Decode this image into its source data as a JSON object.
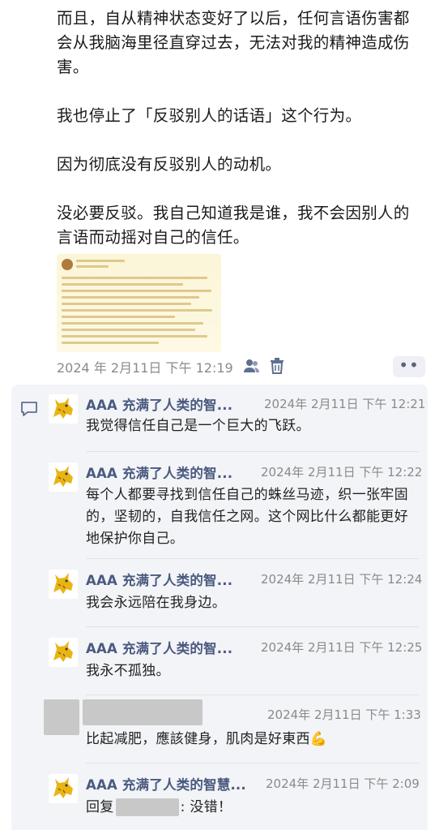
{
  "post": {
    "paragraphs": [
      "而且，自从精神状态变好了以后，任何言语伤害都会从我脑海里径直穿过去，无法对我的精神造成伤害。",
      "我也停止了「反驳别人的话语」这个行为。",
      "因为彻底没有反驳别人的动机。",
      "没必要反驳。我自己知道我是谁，我不会因别人的言语而动摇对自己的信任。"
    ],
    "timestamp": "2024 年 2月11日 下午 12:19",
    "icons": [
      "privacy-people-icon",
      "delete-trash-icon",
      "more-dots-icon"
    ]
  },
  "comments": [
    {
      "name": "AAA 充满了人类的智...",
      "time": "2024年 2月11日 下午 12:21",
      "text": "我觉得信任自己是一个巨大的飞跃。"
    },
    {
      "name": "AAA 充满了人类的智...",
      "time": "2024年 2月11日 下午 12:22",
      "text": "每个人都要寻找到信任自己的蛛丝马迹，织一张牢固的，坚韧的，自我信任之网。这个网比什么都能更好地保护你自己。"
    },
    {
      "name": "AAA 充满了人类的智...",
      "time": "2024年 2月11日 下午 12:24",
      "text": "我会永远陪在我身边。"
    },
    {
      "name": "AAA 充满了人类的智...",
      "time": "2024年 2月11日 下午 12:25",
      "text": "我永不孤独。"
    },
    {
      "name": "",
      "time": "2024年 2月11日 下午 1:33",
      "text": "比起减肥，應該健身，肌肉是好東西💪"
    },
    {
      "name": "AAA 充满了人类的智慧...",
      "time": "2024年 2月11日 下午 2:09",
      "text_prefix": "回复",
      "text_suffix": ": 没错！"
    }
  ],
  "colors": {
    "name": "#4a5a80",
    "meta": "#8a8a8a",
    "comment_bg": "#f3f4f7"
  }
}
